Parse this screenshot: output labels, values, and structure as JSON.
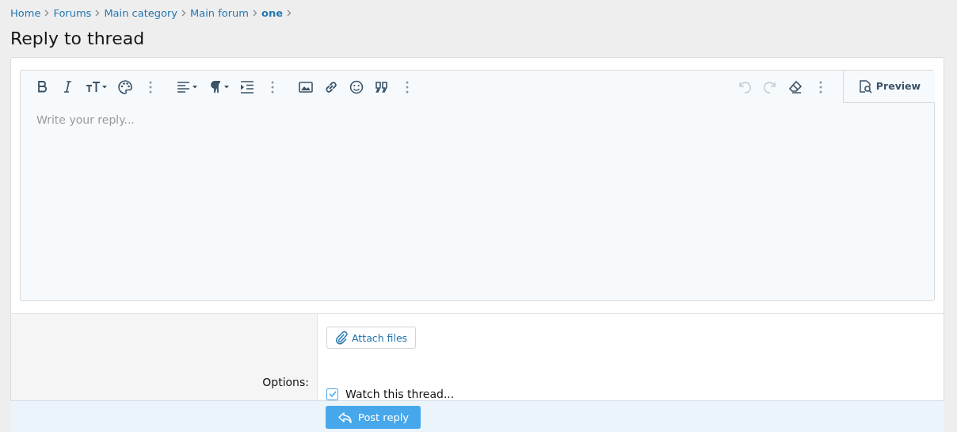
{
  "breadcrumb": [
    {
      "label": "Home",
      "current": false
    },
    {
      "label": "Forums",
      "current": false
    },
    {
      "label": "Main category",
      "current": false
    },
    {
      "label": "Main forum",
      "current": false
    },
    {
      "label": "one",
      "current": true
    }
  ],
  "title": "Reply to thread",
  "editor": {
    "toolbar_left": [
      [
        {
          "kind": "bold",
          "dropdown": false,
          "disabled": false
        },
        {
          "kind": "italic",
          "dropdown": false,
          "disabled": false
        },
        {
          "kind": "text-size",
          "dropdown": true,
          "disabled": false
        },
        {
          "kind": "palette",
          "dropdown": false,
          "disabled": false
        },
        {
          "kind": "more",
          "dropdown": false,
          "disabled": false
        }
      ],
      [
        {
          "kind": "align",
          "dropdown": true,
          "disabled": false
        },
        {
          "kind": "paragraph",
          "dropdown": true,
          "disabled": false
        },
        {
          "kind": "indent",
          "dropdown": false,
          "disabled": false
        },
        {
          "kind": "more",
          "dropdown": false,
          "disabled": false
        }
      ],
      [
        {
          "kind": "image",
          "dropdown": false,
          "disabled": false
        },
        {
          "kind": "link",
          "dropdown": false,
          "disabled": false
        },
        {
          "kind": "smiley",
          "dropdown": false,
          "disabled": false
        },
        {
          "kind": "quote",
          "dropdown": false,
          "disabled": false
        },
        {
          "kind": "more",
          "dropdown": false,
          "disabled": false
        }
      ]
    ],
    "toolbar_right": [
      {
        "kind": "undo",
        "dropdown": false,
        "disabled": true
      },
      {
        "kind": "redo",
        "dropdown": false,
        "disabled": true
      },
      {
        "kind": "eraser",
        "dropdown": false,
        "disabled": false
      },
      {
        "kind": "more",
        "dropdown": false,
        "disabled": false
      }
    ],
    "preview_button": "Preview",
    "placeholder": "Write your reply..."
  },
  "attach_button": "Attach files",
  "options_label": "Options:",
  "options": [
    {
      "label": "Watch this thread...",
      "checked": true
    }
  ],
  "submit_button": "Post reply"
}
